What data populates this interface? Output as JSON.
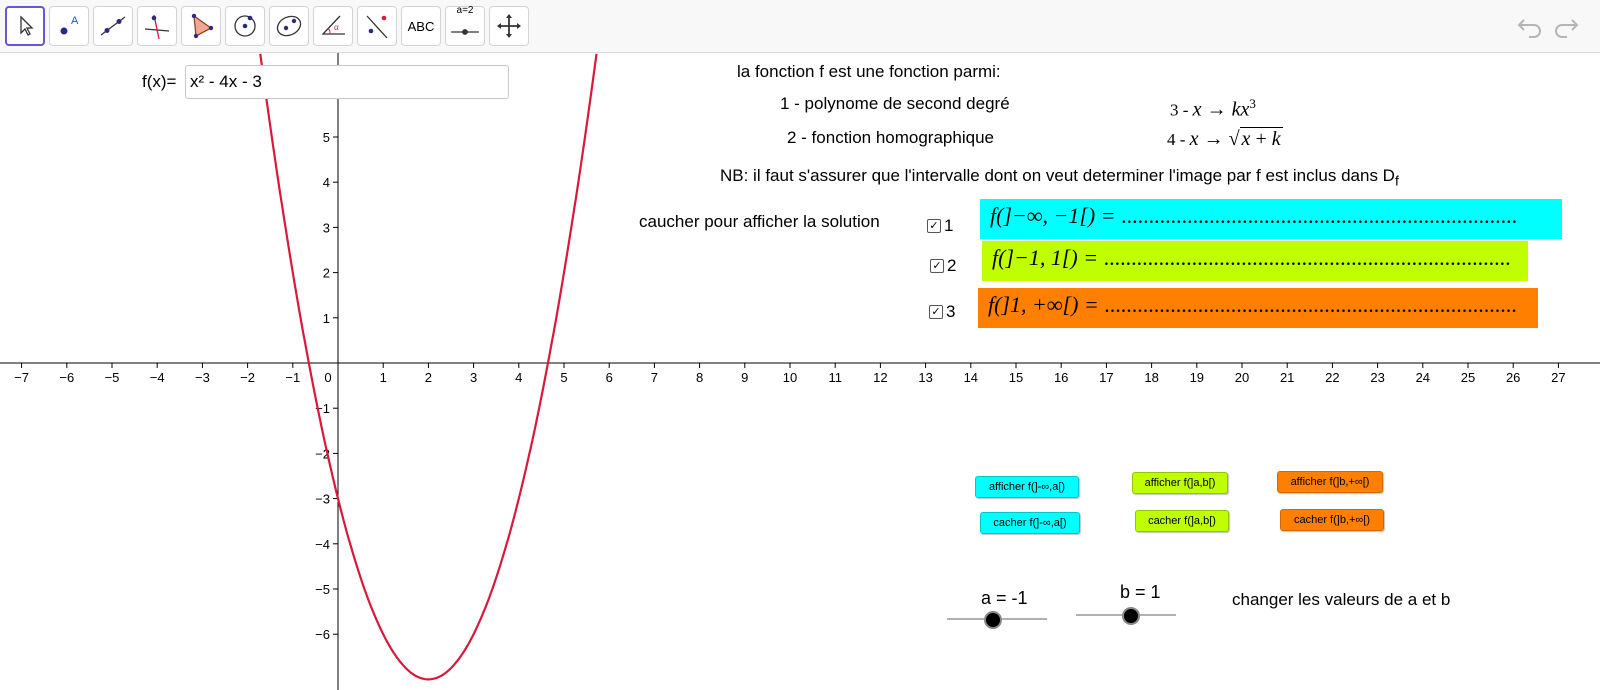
{
  "toolbar": {
    "tools": [
      {
        "name": "move-tool-button"
      },
      {
        "name": "point-tool-button"
      },
      {
        "name": "line-tool-button"
      },
      {
        "name": "perpendicular-tool-button"
      },
      {
        "name": "polygon-tool-button"
      },
      {
        "name": "circle-tool-button"
      },
      {
        "name": "conic-tool-button"
      },
      {
        "name": "angle-tool-button"
      },
      {
        "name": "reflect-tool-button"
      },
      {
        "name": "text-tool-button",
        "label": "ABC"
      },
      {
        "name": "slider-tool-button",
        "label": "a=2"
      },
      {
        "name": "move-view-tool-button"
      }
    ],
    "undo_icon": "undo-icon",
    "redo_icon": "redo-icon"
  },
  "input": {
    "label": "f(x)=",
    "value": "x² - 4x - 3"
  },
  "info": {
    "intro": "la  fonction  f est une fonction parmi:",
    "item1": "1 - polynome de second degré",
    "item2": "2 - fonction homographique",
    "item3_num": "3 - ",
    "item4_num": "4 - ",
    "nb": "NB: il faut s'assurer que l'intervalle dont on veut determiner l'image par f est inclus dans D",
    "nb_sub": "f",
    "hide_prompt": "caucher pour afficher la solution"
  },
  "checkboxes": [
    {
      "label": "1",
      "checked": true
    },
    {
      "label": "2",
      "checked": true
    },
    {
      "label": "3",
      "checked": true
    }
  ],
  "bands": [
    {
      "lhs": "f(]−∞, −1[) = ",
      "dots": "........................................................................",
      "color": "#00ffff"
    },
    {
      "lhs": "f(]−1, 1[) = ",
      "dots": "..........................................................................",
      "color": "#bfff00"
    },
    {
      "lhs": "f(]1, +∞[) = ",
      "dots": "...........................................................................",
      "color": "#ff8000"
    }
  ],
  "buttons": {
    "show1": "afficher f(]-∞,a[)",
    "hide1": "cacher f(]-∞,a[)",
    "show2": "afficher f(]a,b[)",
    "hide2": "cacher f(]a,b[)",
    "show3": "afficher f(]b,+∞[)",
    "hide3": "cacher  f(]b,+∞[)"
  },
  "sliders": {
    "a_label": "a = -1",
    "b_label": "b = 1",
    "a_value": -1,
    "b_value": 1,
    "hint": "changer les valeurs de a et b"
  },
  "chart_data": {
    "type": "line",
    "function": "x² - 4x - 3",
    "xlim": [
      -7.3,
      27.7
    ],
    "ylim": [
      -7,
      6.6
    ],
    "x_ticks": [
      -7,
      -6,
      -5,
      -4,
      -3,
      -2,
      -1,
      0,
      1,
      2,
      3,
      4,
      5,
      6,
      7,
      8,
      9,
      10,
      11,
      12,
      13,
      14,
      15,
      16,
      17,
      18,
      19,
      20,
      21,
      22,
      23,
      24,
      25,
      26,
      27
    ],
    "y_ticks": [
      -6,
      -5,
      -4,
      -3,
      -2,
      -1,
      1,
      2,
      3,
      4,
      5
    ],
    "curve_color": "#d8193c",
    "grid": false
  }
}
